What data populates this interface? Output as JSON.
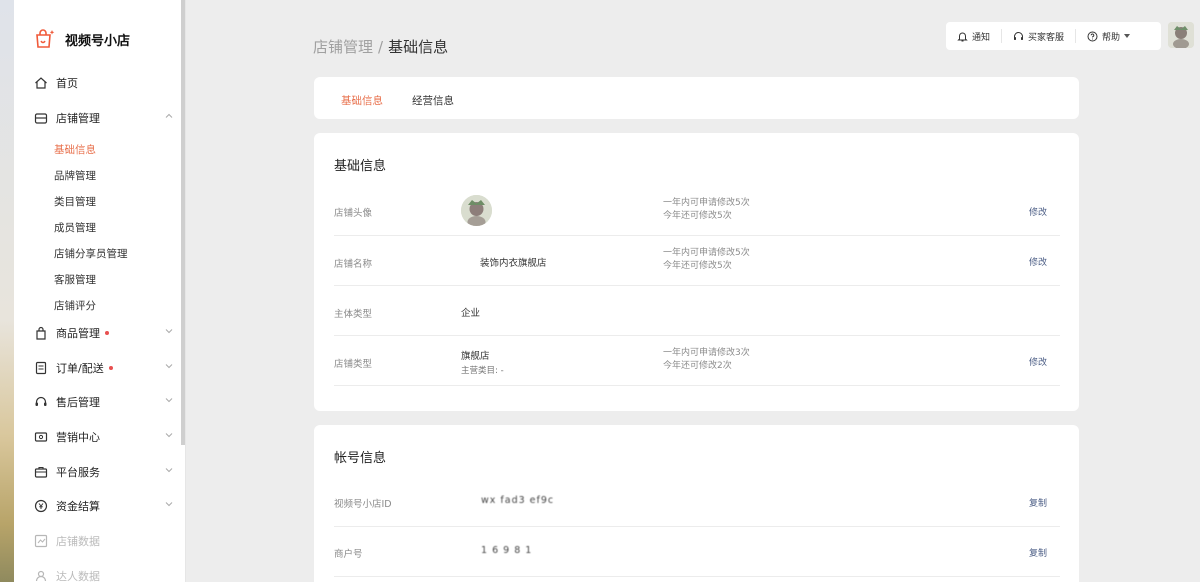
{
  "app": {
    "title": "视频号小店"
  },
  "sidebar": {
    "home": "首页",
    "shop_mgmt": "店铺管理",
    "sub_items": [
      "基础信息",
      "品牌管理",
      "类目管理",
      "成员管理",
      "店铺分享员管理",
      "客服管理",
      "店铺评分"
    ],
    "product_mgmt": "商品管理",
    "orders": "订单/配送",
    "after_sales": "售后管理",
    "marketing": "营销中心",
    "platform": "平台服务",
    "finance": "资金结算",
    "shop_data": "店铺数据",
    "more": "达人数据"
  },
  "header": {
    "breadcrumb_parent": "店铺管理",
    "breadcrumb_sep": "/",
    "breadcrumb_current": "基础信息",
    "notify": "通知",
    "buyer_service": "买家客服",
    "help": "帮助"
  },
  "tabs": {
    "basic": "基础信息",
    "business": "经营信息"
  },
  "basic": {
    "title": "基础信息",
    "rows": [
      {
        "label": "店铺头像",
        "note1": "一年内可申请修改5次",
        "note2": "今年还可修改5次",
        "action": "修改"
      },
      {
        "label": "店铺名称",
        "value": "装饰内衣旗舰店",
        "note1": "一年内可申请修改5次",
        "note2": "今年还可修改5次",
        "action": "修改"
      },
      {
        "label": "主体类型",
        "value": "企业"
      },
      {
        "label": "店铺类型",
        "value": "旗舰店",
        "value2": "主营类目: -",
        "note1": "一年内可申请修改3次",
        "note2": "今年还可修改2次",
        "action": "修改"
      }
    ]
  },
  "account": {
    "title": "帐号信息",
    "rows": [
      {
        "label": "视频号小店ID",
        "value": "wx fad3 ef9c",
        "action": "复制"
      },
      {
        "label": "商户号",
        "value": "1 6 9 8 1",
        "action": "复制"
      }
    ]
  },
  "colors": {
    "accent": "#e8704c",
    "link": "#4a5c84",
    "badge": "#e85050"
  }
}
